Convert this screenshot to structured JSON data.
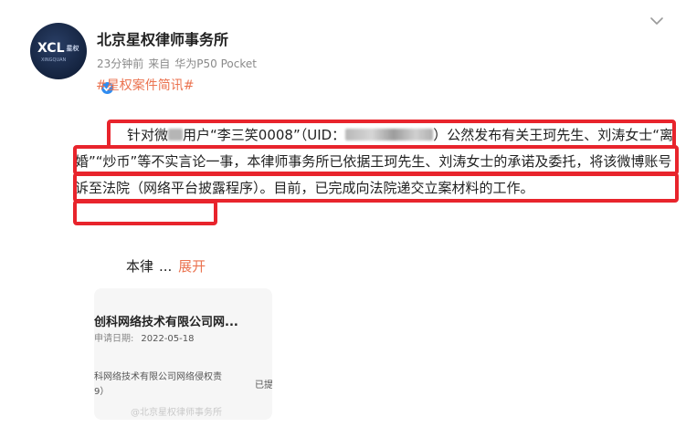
{
  "post": {
    "author": {
      "name": "北京星权律师事务所",
      "avatar_logo": "XCL",
      "avatar_logo_sub": "星权",
      "avatar_tagline": "XINGQUAN",
      "verified_icon": "verified-badge-icon"
    },
    "meta": {
      "time": "23分钟前",
      "from_label": "来自",
      "device": "华为P50 Pocket"
    },
    "menu_icon": "chevron-down-icon",
    "hashtag": "#星权案件简讯#",
    "body": {
      "part1": "针对微",
      "part2": "用户“李三笑0008”（UID：",
      "part3": "）公然发布有关王珂先生、刘涛女士“离婚”“炒币”等不实言论一事，本律师事务所已依据王珂先生、刘涛女士的承诺及委托，将该微博账号诉至法院（网络平台披露程序）。目前，已完成向法院递交立案材料的工作。"
    },
    "more": {
      "text": "本律",
      "ellipsis": "...",
      "expand_label": "展开"
    },
    "attachment": {
      "title": "创科网络技术有限公司网...",
      "date_label": "申请日期:",
      "date": "2022-05-18",
      "desc_line1": "科网络技术有限公司网络侵权责",
      "desc_line2": "9）",
      "status": "已提",
      "watermark": "@北京星权律师事务所"
    },
    "colors": {
      "accent": "#eb7350",
      "highlight": "#e8242c",
      "verified": "#2f8cf1"
    }
  }
}
